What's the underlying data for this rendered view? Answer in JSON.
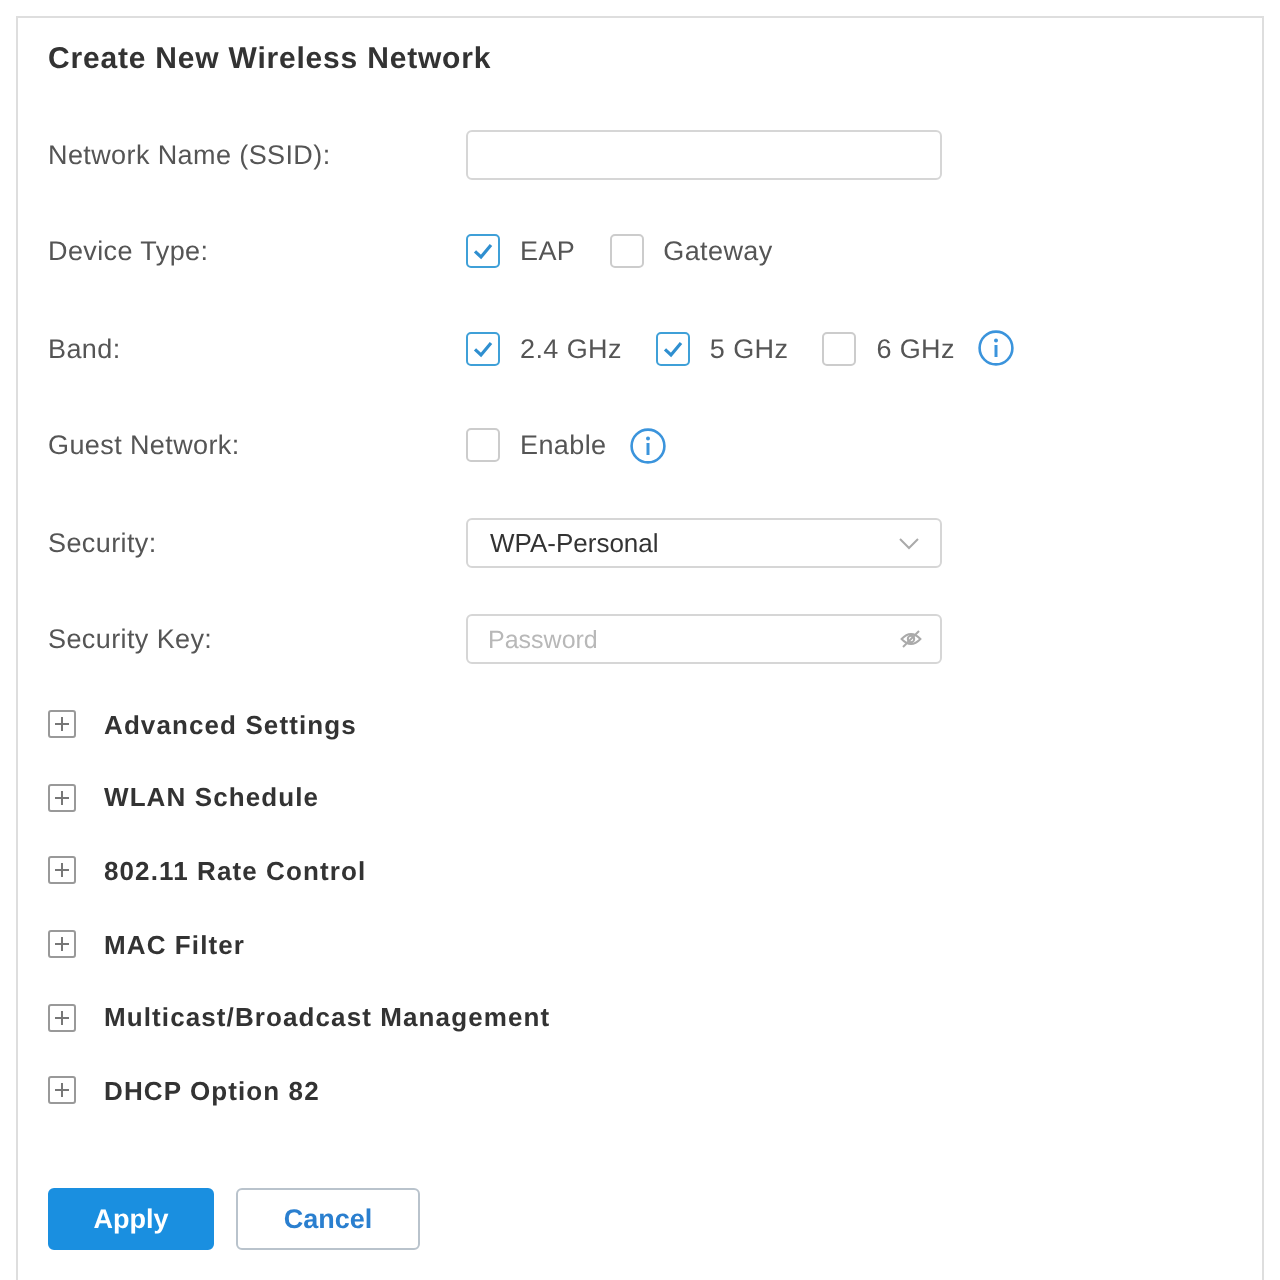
{
  "panel": {
    "title": "Create New Wireless Network",
    "fields": [
      {
        "kind": "text",
        "label": "Network Name (SSID):"
      },
      {
        "kind": "checkboxes",
        "label": "Device Type:",
        "options": [
          {
            "label": "EAP",
            "checked": true
          },
          {
            "label": "Gateway",
            "checked": false
          }
        ]
      },
      {
        "kind": "checkboxes",
        "label": "Band:",
        "options": [
          {
            "label": "2.4 GHz",
            "checked": true
          },
          {
            "label": "5 GHz",
            "checked": true
          },
          {
            "label": "6 GHz",
            "checked": false
          }
        ],
        "info": true
      },
      {
        "kind": "checkboxes",
        "label": "Guest Network:",
        "options": [
          {
            "label": "Enable",
            "checked": false
          }
        ],
        "info": true
      },
      {
        "kind": "select",
        "label": "Security:",
        "value": "WPA-Personal"
      },
      {
        "kind": "password",
        "label": "Security Key:",
        "placeholder": "Password"
      }
    ],
    "sections": [
      {
        "label": "Advanced Settings",
        "expanded": false
      },
      {
        "label": "WLAN Schedule",
        "expanded": false
      },
      {
        "label": "802.11 Rate Control",
        "expanded": false
      },
      {
        "label": "MAC Filter",
        "expanded": false
      },
      {
        "label": "Multicast/Broadcast Management",
        "expanded": false
      },
      {
        "label": "DHCP Option 82",
        "expanded": false
      }
    ],
    "buttons": [
      {
        "label": "Apply",
        "kind": "primary"
      },
      {
        "label": "Cancel",
        "kind": "secondary"
      }
    ]
  }
}
